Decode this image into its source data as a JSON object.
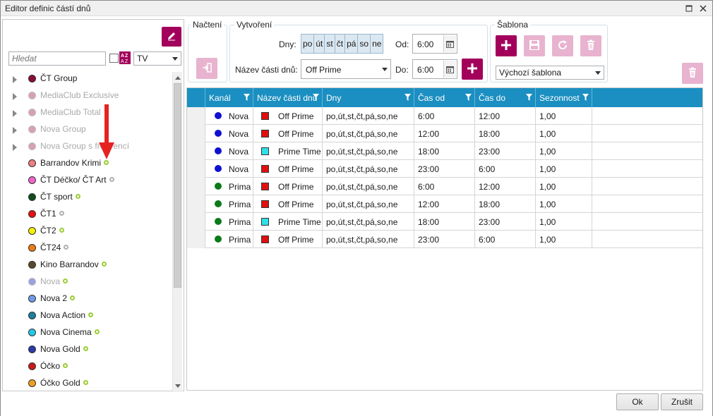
{
  "window": {
    "title": "Editor definic částí dnů"
  },
  "left": {
    "search_placeholder": "Hledat",
    "media_type": "TV",
    "tree": [
      {
        "label": "ČT Group",
        "color": "#8b0a3a",
        "group": true,
        "disabled": false,
        "status": ""
      },
      {
        "label": "MediaClub Exclusive",
        "color": "#d8a0b8",
        "group": true,
        "disabled": true,
        "status": ""
      },
      {
        "label": "MediaClub Total",
        "color": "#d8a0b8",
        "group": true,
        "disabled": true,
        "status": ""
      },
      {
        "label": "Nova Group",
        "color": "#d8a0b8",
        "group": true,
        "disabled": true,
        "status": ""
      },
      {
        "label": "Nova Group s frekvencí",
        "color": "#d8a0b8",
        "group": true,
        "disabled": true,
        "status": ""
      },
      {
        "label": "Barrandov Krimi",
        "color": "#f07c84",
        "group": false,
        "disabled": false,
        "status": "ok"
      },
      {
        "label": "ČT Déčko/ ČT Art",
        "color": "#ee66cc",
        "group": false,
        "disabled": false,
        "status": "na"
      },
      {
        "label": "ČT sport",
        "color": "#0f4d1e",
        "group": false,
        "disabled": false,
        "status": "ok"
      },
      {
        "label": "ČT1",
        "color": "#e81010",
        "group": false,
        "disabled": false,
        "status": "na"
      },
      {
        "label": "ČT2",
        "color": "#f4f000",
        "group": false,
        "disabled": false,
        "status": "ok"
      },
      {
        "label": "ČT24",
        "color": "#f07a10",
        "group": false,
        "disabled": false,
        "status": "na"
      },
      {
        "label": "Kino Barrandov",
        "color": "#5a4a2a",
        "group": false,
        "disabled": false,
        "status": "ok"
      },
      {
        "label": "Nova",
        "color": "#9aa0e0",
        "group": false,
        "disabled": true,
        "status": "ok"
      },
      {
        "label": "Nova 2",
        "color": "#6f9ae8",
        "group": false,
        "disabled": false,
        "status": "ok"
      },
      {
        "label": "Nova Action",
        "color": "#1a7fa0",
        "group": false,
        "disabled": false,
        "status": "ok"
      },
      {
        "label": "Nova Cinema",
        "color": "#22c8e8",
        "group": false,
        "disabled": false,
        "status": "ok"
      },
      {
        "label": "Nova Gold",
        "color": "#2a3aa8",
        "group": false,
        "disabled": false,
        "status": "ok"
      },
      {
        "label": "Óčko",
        "color": "#c81a1a",
        "group": false,
        "disabled": false,
        "status": "ok"
      },
      {
        "label": "Óčko Gold",
        "color": "#f0a020",
        "group": false,
        "disabled": false,
        "status": "ok"
      }
    ]
  },
  "nacteni": {
    "label": "Načtení"
  },
  "vytvoreni": {
    "label": "Vytvoření",
    "days_label": "Dny:",
    "days": [
      "po",
      "út",
      "st",
      "čt",
      "pá",
      "so",
      "ne"
    ],
    "name_label": "Název části dnů:",
    "name_value": "Off Prime",
    "from_label": "Od:",
    "from_value": "6:00",
    "to_label": "Do:",
    "to_value": "6:00"
  },
  "sablona": {
    "label": "Šablona",
    "selected": "Výchozí šablona"
  },
  "grid": {
    "headers": [
      "Kanál",
      "Název části dnů",
      "Dny",
      "Čas od",
      "Čas do",
      "Sezonnost"
    ],
    "rows": [
      {
        "channel": "Nova",
        "channel_color": "#1010d0",
        "part": "Off Prime",
        "part_color": "#e01010",
        "days": "po,út,st,čt,pá,so,ne",
        "from": "6:00",
        "to": "12:00",
        "seasonality": "1,00"
      },
      {
        "channel": "Nova",
        "channel_color": "#1010d0",
        "part": "Off Prime",
        "part_color": "#e01010",
        "days": "po,út,st,čt,pá,so,ne",
        "from": "12:00",
        "to": "18:00",
        "seasonality": "1,00"
      },
      {
        "channel": "Nova",
        "channel_color": "#1010d0",
        "part": "Prime Time",
        "part_color": "#30e0e8",
        "days": "po,út,st,čt,pá,so,ne",
        "from": "18:00",
        "to": "23:00",
        "seasonality": "1,00"
      },
      {
        "channel": "Nova",
        "channel_color": "#1010d0",
        "part": "Off Prime",
        "part_color": "#e01010",
        "days": "po,út,st,čt,pá,so,ne",
        "from": "23:00",
        "to": "6:00",
        "seasonality": "1,00"
      },
      {
        "channel": "Prima",
        "channel_color": "#0a7a1a",
        "part": "Off Prime",
        "part_color": "#e01010",
        "days": "po,út,st,čt,pá,so,ne",
        "from": "6:00",
        "to": "12:00",
        "seasonality": "1,00"
      },
      {
        "channel": "Prima",
        "channel_color": "#0a7a1a",
        "part": "Off Prime",
        "part_color": "#e01010",
        "days": "po,út,st,čt,pá,so,ne",
        "from": "12:00",
        "to": "18:00",
        "seasonality": "1,00"
      },
      {
        "channel": "Prima",
        "channel_color": "#0a7a1a",
        "part": "Prime Time",
        "part_color": "#30e0e8",
        "days": "po,út,st,čt,pá,so,ne",
        "from": "18:00",
        "to": "23:00",
        "seasonality": "1,00"
      },
      {
        "channel": "Prima",
        "channel_color": "#0a7a1a",
        "part": "Off Prime",
        "part_color": "#e01010",
        "days": "po,út,st,čt,pá,so,ne",
        "from": "23:00",
        "to": "6:00",
        "seasonality": "1,00"
      }
    ]
  },
  "footer": {
    "ok": "Ok",
    "cancel": "Zrušit"
  },
  "colors": {
    "accent": "#a3005c",
    "accent_disabled": "#e8b3cf",
    "grid_header": "#1b8fc1"
  }
}
